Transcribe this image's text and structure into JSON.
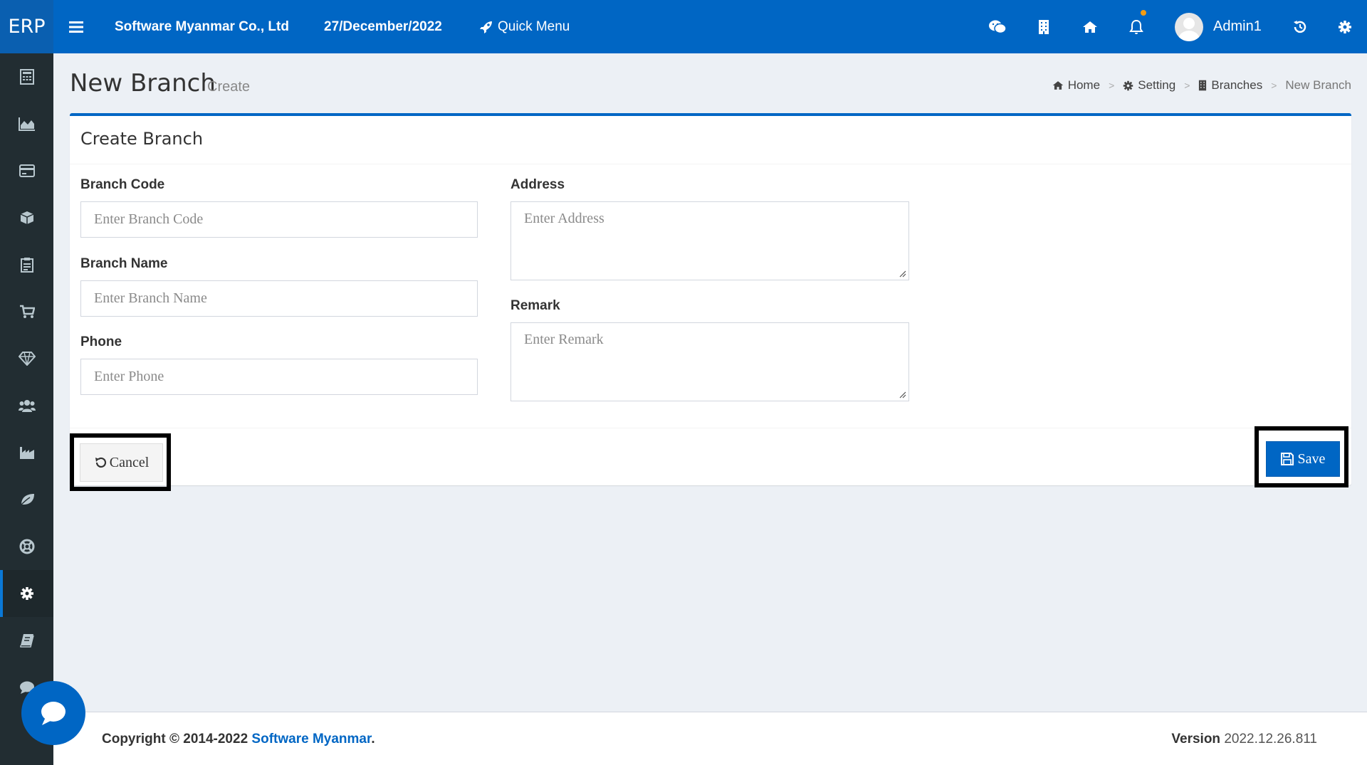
{
  "topbar": {
    "logo": "ERP",
    "company": "Software Myanmar Co., Ltd",
    "date": "27/December/2022",
    "quick_menu": "Quick Menu",
    "username": "Admin1",
    "icons": [
      "menu-icon",
      "rocket-icon",
      "wechat-icon",
      "building-icon",
      "home-icon",
      "bell-icon",
      "history-icon",
      "gear-icon"
    ]
  },
  "sidebar": {
    "items": [
      {
        "icon": "calculator-icon"
      },
      {
        "icon": "area-chart-icon"
      },
      {
        "icon": "credit-card-icon"
      },
      {
        "icon": "cube-icon"
      },
      {
        "icon": "clipboard-icon"
      },
      {
        "icon": "cart-icon"
      },
      {
        "icon": "diamond-icon"
      },
      {
        "icon": "users-icon"
      },
      {
        "icon": "industry-icon"
      },
      {
        "icon": "leaf-icon"
      },
      {
        "icon": "support-icon"
      },
      {
        "icon": "gear-icon",
        "active": true
      },
      {
        "icon": "book-icon"
      },
      {
        "icon": "comment-icon"
      }
    ]
  },
  "header": {
    "title": "New Branch",
    "subtitle": "Create"
  },
  "breadcrumb": {
    "home": "Home",
    "setting": "Setting",
    "branches": "Branches",
    "current": "New Branch",
    "separator": ">"
  },
  "form": {
    "title": "Create Branch",
    "branch_code": {
      "label": "Branch Code",
      "placeholder": "Enter Branch Code",
      "value": ""
    },
    "branch_name": {
      "label": "Branch Name",
      "placeholder": "Enter Branch Name",
      "value": ""
    },
    "phone": {
      "label": "Phone",
      "placeholder": "Enter Phone",
      "value": ""
    },
    "address": {
      "label": "Address",
      "placeholder": "Enter Address",
      "value": ""
    },
    "remark": {
      "label": "Remark",
      "placeholder": "Enter Remark",
      "value": ""
    },
    "cancel_label": "Cancel",
    "save_label": "Save"
  },
  "footer": {
    "copyright_prefix": "Copyright © 2014-2022 ",
    "company_link": "Software Myanmar",
    "copyright_suffix": ".",
    "version_label": "Version",
    "version_value": "2022.12.26.811"
  },
  "colors": {
    "primary": "#0066c4",
    "sidebar": "#222d32",
    "background": "#ecf0f5",
    "notification_dot": "#f39c12"
  }
}
